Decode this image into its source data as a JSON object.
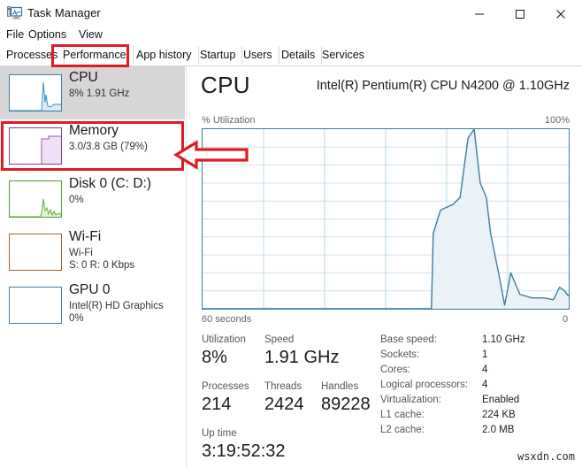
{
  "window": {
    "title": "Task Manager",
    "icon": "task-manager-icon",
    "controls": {
      "minimize": "—",
      "maximize": "□",
      "close": "✕"
    }
  },
  "menubar": {
    "items": [
      {
        "label": "File"
      },
      {
        "label": "Options"
      },
      {
        "label": "View"
      }
    ]
  },
  "tabs": {
    "items": [
      {
        "label": "Processes",
        "selected": false
      },
      {
        "label": "Performance",
        "selected": true
      },
      {
        "label": "App history",
        "selected": false
      },
      {
        "label": "Startup",
        "selected": false
      },
      {
        "label": "Users",
        "selected": false
      },
      {
        "label": "Details",
        "selected": false
      },
      {
        "label": "Services",
        "selected": false
      }
    ]
  },
  "annotations": {
    "performance_tab_box_color": "#e01b24",
    "memory_row_box_color": "#e01b24",
    "arrow_color": "#e01b24",
    "arrow_direction": "left"
  },
  "sidebar": {
    "items": [
      {
        "name": "CPU",
        "title": "CPU",
        "sub1": "8%  1.91 GHz",
        "sub2": "",
        "selected": true,
        "accent": "#3c7e9e"
      },
      {
        "name": "Memory",
        "title": "Memory",
        "sub1": "3.0/3.8 GB (79%)",
        "sub2": "",
        "selected": false,
        "accent": "#7e3f98"
      },
      {
        "name": "Disk 0",
        "title": "Disk 0 (C: D:)",
        "sub1": "0%",
        "sub2": "",
        "selected": false,
        "accent": "#4f9d2a"
      },
      {
        "name": "Wi-Fi",
        "title": "Wi-Fi",
        "sub1": "Wi-Fi",
        "sub2_prefix_s": "S:",
        "sub2_s": " 0 ",
        "sub2_prefix_r": "R:",
        "sub2_r": " 0 Kbps",
        "sub2": "S: 0 R: 0 Kbps",
        "selected": false,
        "accent": "#9c6227"
      },
      {
        "name": "GPU 0",
        "title": "GPU 0",
        "sub1": "Intel(R) HD Graphics",
        "sub2": "0%",
        "selected": false,
        "accent": "#3c7e9e"
      }
    ]
  },
  "main": {
    "heading": "CPU",
    "model": "Intel(R) Pentium(R) CPU N4200 @ 1.10GHz",
    "y_axis_label": "% Utilization",
    "y_axis_max": "100%",
    "x_axis_left": "60 seconds",
    "x_axis_right": "0",
    "stats": [
      {
        "label": "Utilization",
        "value": "8%"
      },
      {
        "label": "Speed",
        "value": "1.91 GHz"
      },
      {
        "label": "Processes",
        "value": "214"
      },
      {
        "label": "Threads",
        "value": "2424"
      },
      {
        "label": "Handles",
        "value": "89228"
      },
      {
        "label": "Up time",
        "value": "3:19:52:32"
      }
    ],
    "info": [
      {
        "key": "Base speed:",
        "value": "1.10 GHz"
      },
      {
        "key": "Sockets:",
        "value": "1"
      },
      {
        "key": "Cores:",
        "value": "4"
      },
      {
        "key": "Logical processors:",
        "value": "4"
      },
      {
        "key": "Virtualization:",
        "value": "Enabled"
      },
      {
        "key": "L1 cache:",
        "value": "224 KB"
      },
      {
        "key": "L2 cache:",
        "value": "2.0 MB"
      }
    ]
  },
  "watermark": "wsxdn.com",
  "chart_data": {
    "type": "area",
    "title": "CPU % Utilization over 60 seconds",
    "xlabel": "60 seconds",
    "ylabel": "% Utilization",
    "xlim": [
      -60,
      0
    ],
    "ylim": [
      0,
      100
    ],
    "grid": true,
    "grid_rows": 10,
    "grid_cols": 6,
    "line_color": "#3c7e9e",
    "fill_color": "#eaf2f7",
    "series": [
      {
        "name": "CPU Utilization",
        "x": [
          -60,
          -22.5,
          -22.2,
          -21.0,
          -19.0,
          -17.8,
          -16.5,
          -15.5,
          -14.5,
          -13.5,
          -12.8,
          -11.5,
          -10.5,
          -9.5,
          -8.0,
          -6.0,
          -4.0,
          -2.5,
          -1.5,
          -0.7,
          0
        ],
        "values": [
          0,
          0,
          42,
          55,
          58,
          62,
          95,
          100,
          70,
          62,
          42,
          20,
          2,
          20,
          8,
          6,
          6,
          5,
          12,
          10,
          7
        ]
      }
    ]
  }
}
